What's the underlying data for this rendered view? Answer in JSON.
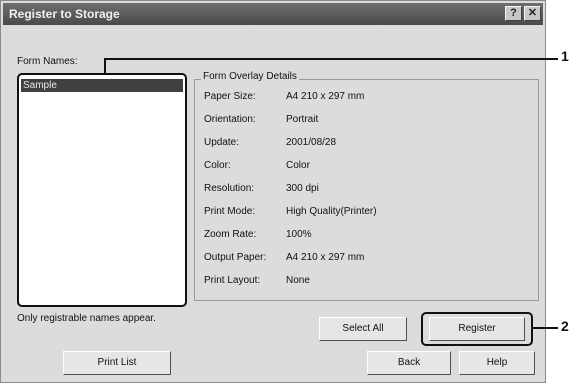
{
  "window": {
    "title": "Register to Storage",
    "help_glyph": "?",
    "close_glyph": "✕"
  },
  "form_names": {
    "label": "Form Names:",
    "items": [
      "Sample"
    ],
    "note": "Only registrable names appear."
  },
  "details": {
    "group_title": "Form Overlay Details",
    "rows": [
      {
        "key": "Paper Size:",
        "value": "A4 210 x 297 mm"
      },
      {
        "key": "Orientation:",
        "value": "Portrait"
      },
      {
        "key": "Update:",
        "value": "2001/08/28"
      },
      {
        "key": "Color:",
        "value": "Color"
      },
      {
        "key": "Resolution:",
        "value": "300 dpi"
      },
      {
        "key": "Print Mode:",
        "value": "High Quality(Printer)"
      },
      {
        "key": "Zoom Rate:",
        "value": "100%"
      },
      {
        "key": "Output Paper:",
        "value": "A4 210 x 297 mm"
      },
      {
        "key": "Print Layout:",
        "value": "None"
      }
    ]
  },
  "buttons": {
    "select_all": "Select All",
    "register": "Register",
    "print_list": "Print List",
    "back": "Back",
    "help": "Help"
  },
  "callouts": [
    "1",
    "2"
  ]
}
